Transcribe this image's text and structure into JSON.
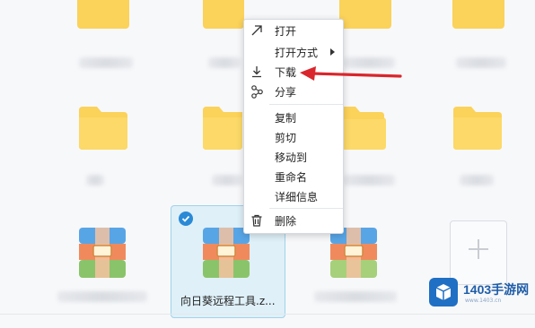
{
  "context_menu": {
    "items": [
      {
        "label": "打开",
        "icon": "open-arrow-icon"
      },
      {
        "label": "打开方式",
        "has_submenu": true
      },
      {
        "label": "下载",
        "icon": "download-icon"
      },
      {
        "label": "分享",
        "icon": "share-icon"
      },
      {
        "label": "复制"
      },
      {
        "label": "剪切"
      },
      {
        "label": "移动到"
      },
      {
        "label": "重命名"
      },
      {
        "label": "详细信息"
      },
      {
        "label": "删除",
        "icon": "trash-icon"
      }
    ]
  },
  "files": {
    "selected_name": "向日葵远程工具.z..."
  },
  "watermark": {
    "brand": "1403手游网",
    "url": "www.1403.cn"
  },
  "colors": {
    "folder": "#fbd25a",
    "selection_bg": "#dff0f8",
    "selection_border": "#9fd3ea",
    "accent": "#2a8ad6",
    "annotation_arrow": "#d9262c"
  }
}
